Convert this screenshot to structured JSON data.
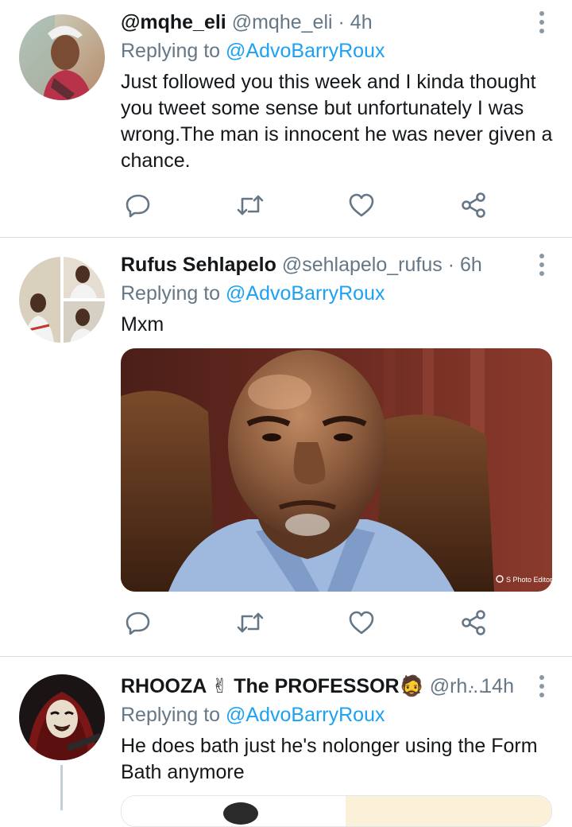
{
  "tweets": [
    {
      "display_name": "@mqhe_eli",
      "handle": "@mqhe_eli",
      "separator": "·",
      "time": "4h",
      "replying_prefix": "Replying to",
      "replying_to": "@AdvoBarryRoux",
      "text_lines": [
        "Just followed you this week and I kinda  thought",
        "you tweet some sense but unfortunately I was",
        "wrong.The man is innocent he was never given a",
        "chance."
      ]
    },
    {
      "display_name": "Rufus Sehlapelo",
      "handle": "@sehlapelo_rufus",
      "separator": "·",
      "time": "6h",
      "replying_prefix": "Replying to",
      "replying_to": "@AdvoBarryRoux",
      "text_lines": [
        "Mxm"
      ],
      "media_watermark": "S Photo Editor"
    },
    {
      "display_name": "RHOOZA ✌ The PROFESSOR🧔",
      "handle": "@rh...",
      "separator": "·",
      "time": "14h",
      "replying_prefix": "Replying to",
      "replying_to": "@AdvoBarryRoux",
      "text_lines": [
        "He does bath just he's nolonger using the Form",
        "Bath anymore"
      ]
    }
  ],
  "action_icons": [
    "reply-icon",
    "retweet-icon",
    "like-icon",
    "share-icon"
  ],
  "colors": {
    "text": "#14171a",
    "secondary": "#657786",
    "link": "#1da1f2",
    "icon": "#657786",
    "divider": "#d6dde3"
  }
}
